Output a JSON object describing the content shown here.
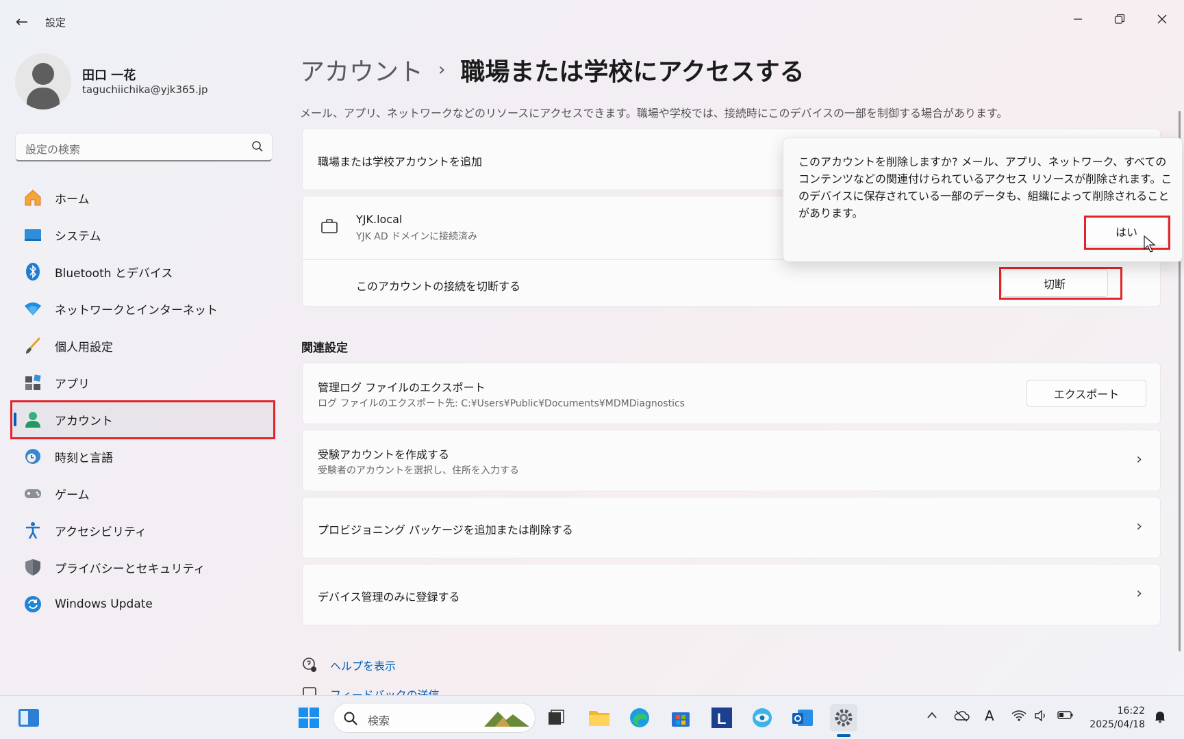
{
  "window": {
    "app_title": "設定",
    "back_icon": "back-arrow-icon",
    "controls": [
      "minimize-icon",
      "maximize-icon",
      "close-icon"
    ]
  },
  "profile": {
    "name": "田口 一花",
    "email": "taguchiichika@yjk365.jp"
  },
  "search": {
    "placeholder": "設定の検索"
  },
  "sidebar": {
    "items": [
      {
        "label": "ホーム",
        "icon": "home-icon"
      },
      {
        "label": "システム",
        "icon": "system-icon"
      },
      {
        "label": "Bluetooth とデバイス",
        "icon": "bluetooth-icon"
      },
      {
        "label": "ネットワークとインターネット",
        "icon": "network-icon"
      },
      {
        "label": "個人用設定",
        "icon": "brush-icon"
      },
      {
        "label": "アプリ",
        "icon": "apps-icon"
      },
      {
        "label": "アカウント",
        "icon": "account-icon",
        "selected": true
      },
      {
        "label": "時刻と言語",
        "icon": "time-language-icon"
      },
      {
        "label": "ゲーム",
        "icon": "game-icon"
      },
      {
        "label": "アクセシビリティ",
        "icon": "accessibility-icon"
      },
      {
        "label": "プライバシーとセキュリティ",
        "icon": "shield-icon"
      },
      {
        "label": "Windows Update",
        "icon": "update-icon"
      }
    ]
  },
  "main": {
    "breadcrumb_parent": "アカウント",
    "breadcrumb_separator": "›",
    "page_title": "職場または学校にアクセスする",
    "description": "メール、アプリ、ネットワークなどのリソースにアクセスできます。職場や学校では、接続時にこのデバイスの一部を制御する場合があります。",
    "add_account": "職場または学校アカウントを追加",
    "account": {
      "name": "YJK.local",
      "status": "YJK AD ドメインに接続済み",
      "disconnect_text": "このアカウントの接続を切断する",
      "disconnect_button": "切断"
    },
    "related_title": "関連設定",
    "related": [
      {
        "title": "管理ログ ファイルのエクスポート",
        "sub": "ログ ファイルのエクスポート先: C:¥Users¥Public¥Documents¥MDMDiagnostics",
        "button": "エクスポート"
      },
      {
        "title": "受験アカウントを作成する",
        "sub": "受験者のアカウントを選択し、住所を入力する"
      },
      {
        "title": "プロビジョニング パッケージを追加または削除する"
      },
      {
        "title": "デバイス管理のみに登録する"
      }
    ],
    "links": [
      {
        "label": "ヘルプを表示",
        "icon": "help-icon"
      },
      {
        "label": "フィードバックの送信",
        "icon": "feedback-icon"
      }
    ]
  },
  "flyout": {
    "message": "このアカウントを削除しますか? メール、アプリ、ネットワーク、すべてのコンテンツなどの関連付けられているアクセス リソースが削除されます。このデバイスに保存されている一部のデータも、組織によって削除されることがあります。",
    "yes_button": "はい"
  },
  "taskbar": {
    "search_placeholder": "検索",
    "time": "16:22",
    "date": "2025/04/18",
    "ime": "A"
  },
  "colors": {
    "accent": "#005fb8",
    "highlight": "#e0242a"
  }
}
